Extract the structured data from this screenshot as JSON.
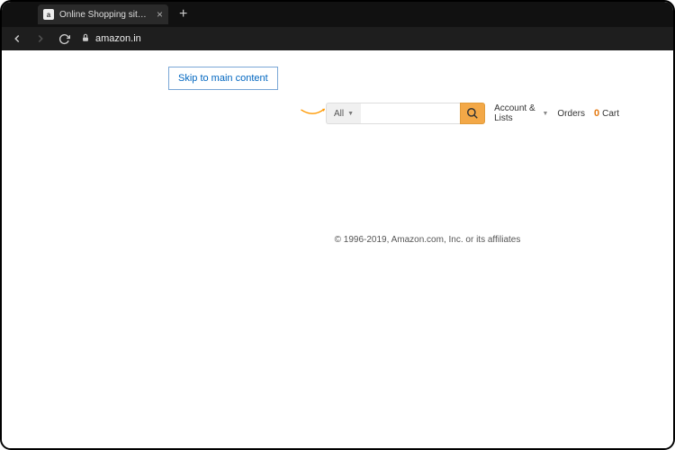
{
  "browser": {
    "tab_title": "Online Shopping site in India: Shop",
    "url": "amazon.in"
  },
  "page": {
    "skip_link": "Skip to main content",
    "search": {
      "category": "All",
      "value": "",
      "placeholder": ""
    },
    "nav": {
      "account": "Account & Lists",
      "orders": "Orders",
      "cart_label": "Cart",
      "cart_count": "0"
    },
    "footer": "© 1996-2019, Amazon.com, Inc. or its affiliates"
  },
  "colors": {
    "accent_orange": "#f3a847",
    "link_blue": "#0066c0",
    "cart_orange": "#e47911"
  }
}
